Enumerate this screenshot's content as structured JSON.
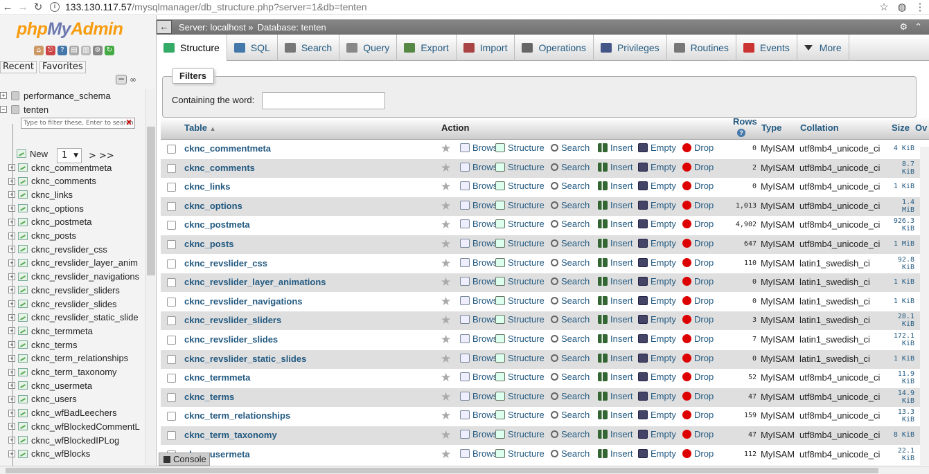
{
  "browser": {
    "url_host": "133.130.117.57",
    "url_path": "/mysqlmanager/db_structure.php?server=1&db=tenten",
    "back_icon": "arrow-left-icon",
    "forward_icon": "arrow-right-icon",
    "reload_icon": "reload-icon",
    "info_icon": "info-icon",
    "bookmark_icon": "star-icon"
  },
  "nav": {
    "logo_php": "php",
    "logo_my": "My",
    "logo_admin": "Admin",
    "recent": "Recent",
    "favorites": "Favorites",
    "databases": [
      "performance_schema",
      "tenten"
    ],
    "filter_placeholder": "Type to filter these, Enter to search",
    "filter_clear": "X",
    "page_value": "1",
    "page_next": "> >>",
    "new_label": "New",
    "tables": [
      "cknc_commentmeta",
      "cknc_comments",
      "cknc_links",
      "cknc_options",
      "cknc_postmeta",
      "cknc_posts",
      "cknc_revslider_css",
      "cknc_revslider_layer_anim",
      "cknc_revslider_navigations",
      "cknc_revslider_sliders",
      "cknc_revslider_slides",
      "cknc_revslider_static_slide",
      "cknc_termmeta",
      "cknc_terms",
      "cknc_term_relationships",
      "cknc_term_taxonomy",
      "cknc_usermeta",
      "cknc_users",
      "cknc_wfBadLeechers",
      "cknc_wfBlockedCommentL",
      "cknc_wfBlockedIPLog",
      "cknc_wfBlocks"
    ]
  },
  "breadcrumb": {
    "server": "Server: localhost »",
    "database": "Database: tenten"
  },
  "tabs": [
    "Structure",
    "SQL",
    "Search",
    "Query",
    "Export",
    "Import",
    "Operations",
    "Privileges",
    "Routines",
    "Events",
    "More"
  ],
  "filters": {
    "legend": "Filters",
    "label": "Containing the word:",
    "value": ""
  },
  "columns": {
    "table": "Table",
    "action": "Action",
    "rows": "Rows",
    "type": "Type",
    "collation": "Collation",
    "size": "Size",
    "overhead": "Ov"
  },
  "actions": {
    "browse": "Browse",
    "structure": "Structure",
    "search": "Search",
    "insert": "Insert",
    "empty": "Empty",
    "drop": "Drop"
  },
  "rows": [
    {
      "name": "cknc_commentmeta",
      "rows": "0",
      "type": "MyISAM",
      "collation": "utf8mb4_unicode_ci",
      "size": [
        "4 KiB"
      ]
    },
    {
      "name": "cknc_comments",
      "rows": "2",
      "type": "MyISAM",
      "collation": "utf8mb4_unicode_ci",
      "size": [
        "8.7",
        "KiB"
      ]
    },
    {
      "name": "cknc_links",
      "rows": "0",
      "type": "MyISAM",
      "collation": "utf8mb4_unicode_ci",
      "size": [
        "1 KiB"
      ]
    },
    {
      "name": "cknc_options",
      "rows": "1,013",
      "type": "MyISAM",
      "collation": "utf8mb4_unicode_ci",
      "size": [
        "1.4",
        "MiB"
      ]
    },
    {
      "name": "cknc_postmeta",
      "rows": "4,902",
      "type": "MyISAM",
      "collation": "utf8mb4_unicode_ci",
      "size": [
        "926.3",
        "KiB"
      ]
    },
    {
      "name": "cknc_posts",
      "rows": "647",
      "type": "MyISAM",
      "collation": "utf8mb4_unicode_ci",
      "size": [
        "1 MiB"
      ]
    },
    {
      "name": "cknc_revslider_css",
      "rows": "110",
      "type": "MyISAM",
      "collation": "latin1_swedish_ci",
      "size": [
        "92.8",
        "KiB"
      ]
    },
    {
      "name": "cknc_revslider_layer_animations",
      "rows": "0",
      "type": "MyISAM",
      "collation": "latin1_swedish_ci",
      "size": [
        "1 KiB"
      ]
    },
    {
      "name": "cknc_revslider_navigations",
      "rows": "0",
      "type": "MyISAM",
      "collation": "latin1_swedish_ci",
      "size": [
        "1 KiB"
      ]
    },
    {
      "name": "cknc_revslider_sliders",
      "rows": "3",
      "type": "MyISAM",
      "collation": "latin1_swedish_ci",
      "size": [
        "28.1",
        "KiB"
      ]
    },
    {
      "name": "cknc_revslider_slides",
      "rows": "7",
      "type": "MyISAM",
      "collation": "latin1_swedish_ci",
      "size": [
        "172.1",
        "KiB"
      ]
    },
    {
      "name": "cknc_revslider_static_slides",
      "rows": "0",
      "type": "MyISAM",
      "collation": "latin1_swedish_ci",
      "size": [
        "1 KiB"
      ]
    },
    {
      "name": "cknc_termmeta",
      "rows": "52",
      "type": "MyISAM",
      "collation": "utf8mb4_unicode_ci",
      "size": [
        "11.9",
        "KiB"
      ]
    },
    {
      "name": "cknc_terms",
      "rows": "47",
      "type": "MyISAM",
      "collation": "utf8mb4_unicode_ci",
      "size": [
        "14.9",
        "KiB"
      ]
    },
    {
      "name": "cknc_term_relationships",
      "rows": "159",
      "type": "MyISAM",
      "collation": "utf8mb4_unicode_ci",
      "size": [
        "13.3",
        "KiB"
      ]
    },
    {
      "name": "cknc_term_taxonomy",
      "rows": "47",
      "type": "MyISAM",
      "collation": "utf8mb4_unicode_ci",
      "size": [
        "8 KiB"
      ]
    },
    {
      "name": "cknc_usermeta",
      "rows": "112",
      "type": "MyISAM",
      "collation": "utf8mb4_unicode_ci",
      "size": [
        "22.1",
        "KiB"
      ]
    }
  ],
  "console": "Console"
}
